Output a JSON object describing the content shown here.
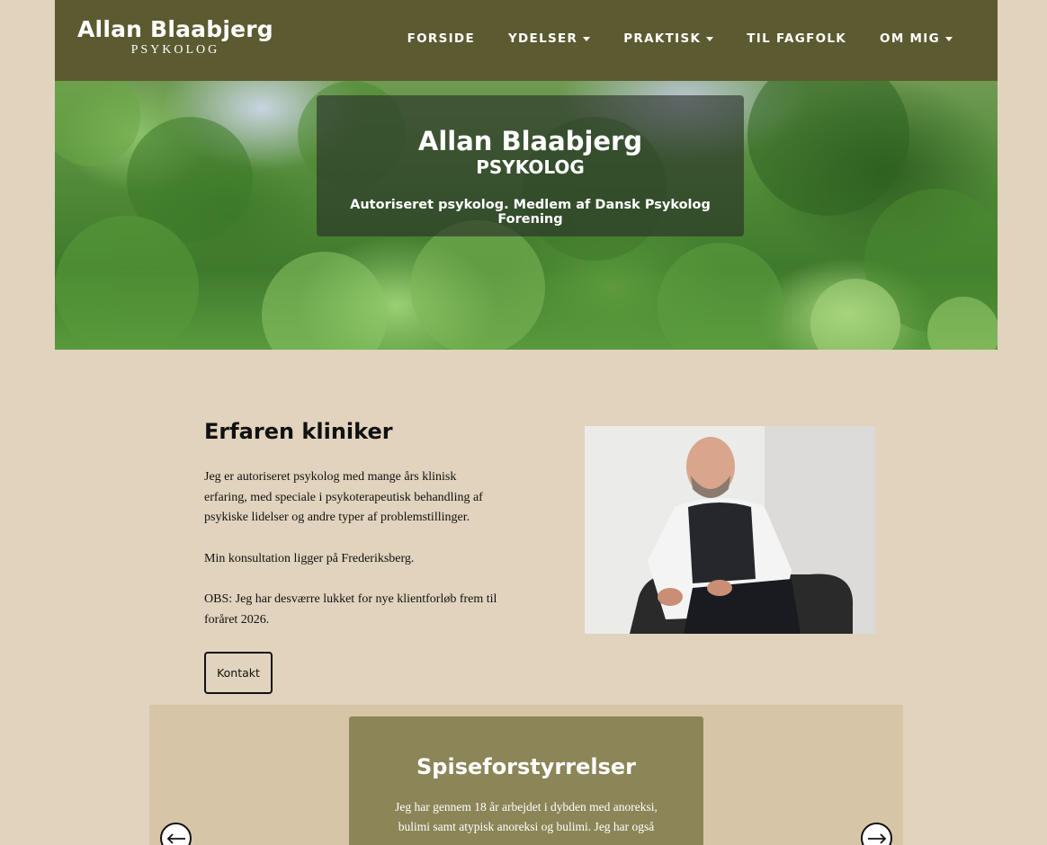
{
  "header": {
    "logo_name": "Allan Blaabjerg",
    "logo_sub": "PSYKOLOG",
    "nav": [
      {
        "label": "FORSIDE",
        "dropdown": false
      },
      {
        "label": "YDELSER",
        "dropdown": true
      },
      {
        "label": "PRAKTISK",
        "dropdown": true
      },
      {
        "label": "TIL FAGFOLK",
        "dropdown": false
      },
      {
        "label": "OM MIG",
        "dropdown": true
      }
    ]
  },
  "hero": {
    "title": "Allan Blaabjerg",
    "subtitle": "PSYKOLOG",
    "tagline": "Autoriseret psykolog. Medlem af Dansk Psykolog Forening"
  },
  "intro": {
    "title": "Erfaren kliniker",
    "paragraphs": [
      "Jeg er autoriseret psykolog med mange års klinisk erfaring, med speciale i psykoterapeutisk behandling af psykiske lidelser og andre typer af problemstillinger.",
      "Min konsultation ligger på Frederiksberg.",
      "OBS: Jeg har desværre lukket for nye klientforløb frem til foråret 2026."
    ],
    "button": "Kontakt"
  },
  "slider": {
    "title": "Spiseforstyrrelser",
    "text": "Jeg har gennem 18 år arbejdet i dybden med anoreksi, bulimi samt atypisk anoreksi og bulimi. Jeg har også"
  },
  "colors": {
    "page_bg": "#e1d3bd",
    "header_bg": "#5c5a30",
    "slider_bg": "#d6c6a7",
    "card_bg": "#8b8557"
  }
}
